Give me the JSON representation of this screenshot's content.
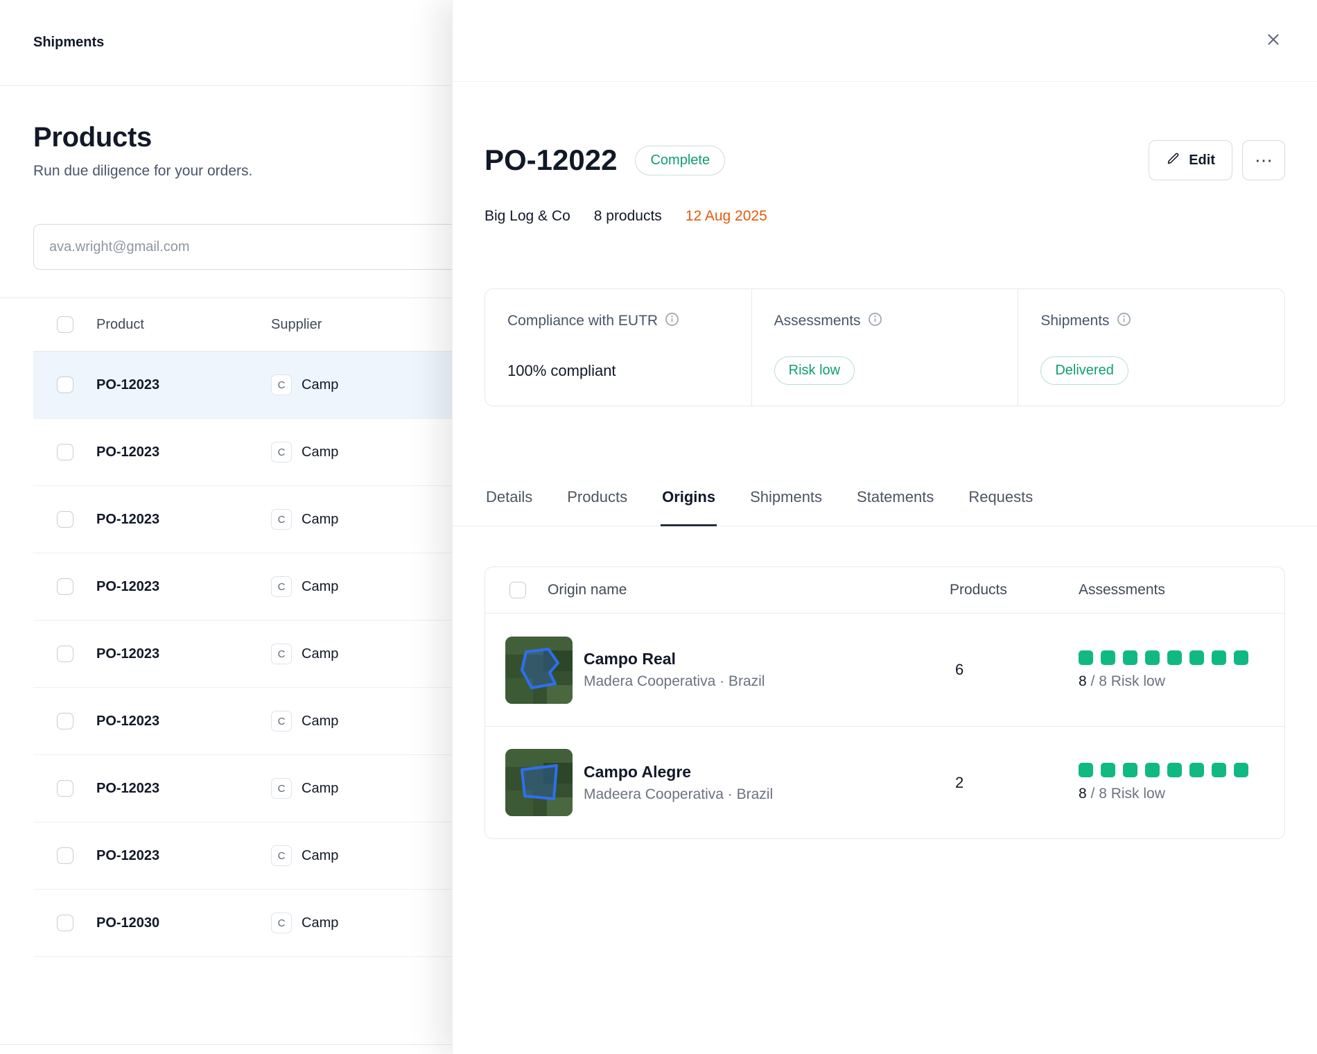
{
  "left_panel": {
    "header_title": "Shipments",
    "title": "Products",
    "subtitle": "Run due diligence for your orders.",
    "search_placeholder": "ava.wright@gmail.com",
    "table": {
      "columns": [
        "Product",
        "Supplier"
      ],
      "rows": [
        {
          "product": "PO-12023",
          "supplier_initial": "C",
          "supplier": "Camp",
          "selected": true
        },
        {
          "product": "PO-12023",
          "supplier_initial": "C",
          "supplier": "Camp"
        },
        {
          "product": "PO-12023",
          "supplier_initial": "C",
          "supplier": "Camp"
        },
        {
          "product": "PO-12023",
          "supplier_initial": "C",
          "supplier": "Camp"
        },
        {
          "product": "PO-12023",
          "supplier_initial": "C",
          "supplier": "Camp"
        },
        {
          "product": "PO-12023",
          "supplier_initial": "C",
          "supplier": "Camp"
        },
        {
          "product": "PO-12023",
          "supplier_initial": "C",
          "supplier": "Camp"
        },
        {
          "product": "PO-12023",
          "supplier_initial": "C",
          "supplier": "Camp"
        },
        {
          "product": "PO-12030",
          "supplier_initial": "C",
          "supplier": "Camp"
        }
      ]
    }
  },
  "drawer": {
    "title": "PO-12022",
    "status_badge": "Complete",
    "edit_label": "Edit",
    "more_label": "⋯",
    "meta": {
      "supplier": "Big Log & Co",
      "products_count": "8 products",
      "date": "12 Aug 2025"
    },
    "stats": {
      "compliance": {
        "label": "Compliance with EUTR",
        "value": "100% compliant"
      },
      "assessments": {
        "label": "Assessments",
        "value": "Risk low"
      },
      "shipments": {
        "label": "Shipments",
        "value": "Delivered"
      }
    },
    "tabs": [
      {
        "label": "Details"
      },
      {
        "label": "Products"
      },
      {
        "label": "Origins",
        "active": true
      },
      {
        "label": "Shipments"
      },
      {
        "label": "Statements"
      },
      {
        "label": "Requests"
      }
    ],
    "origins": {
      "columns": [
        "Origin name",
        "Products",
        "Assessments"
      ],
      "rows": [
        {
          "name": "Campo Real",
          "location": "Madera Cooperativa · Brazil",
          "products": "6",
          "risk_count": "8",
          "risk_rest": "/ 8 Risk low"
        },
        {
          "name": "Campo Alegre",
          "location": "Madeera Cooperativa · Brazil",
          "products": "2",
          "risk_count": "8",
          "risk_rest": "/ 8 Risk low"
        }
      ]
    }
  },
  "colors": {
    "accent_green": "#0e9f6e",
    "square_green": "#10b981",
    "date_orange": "#e8590c",
    "selected_row_blue": "#eef5fc",
    "polygon_blue": "#2f6fed"
  }
}
